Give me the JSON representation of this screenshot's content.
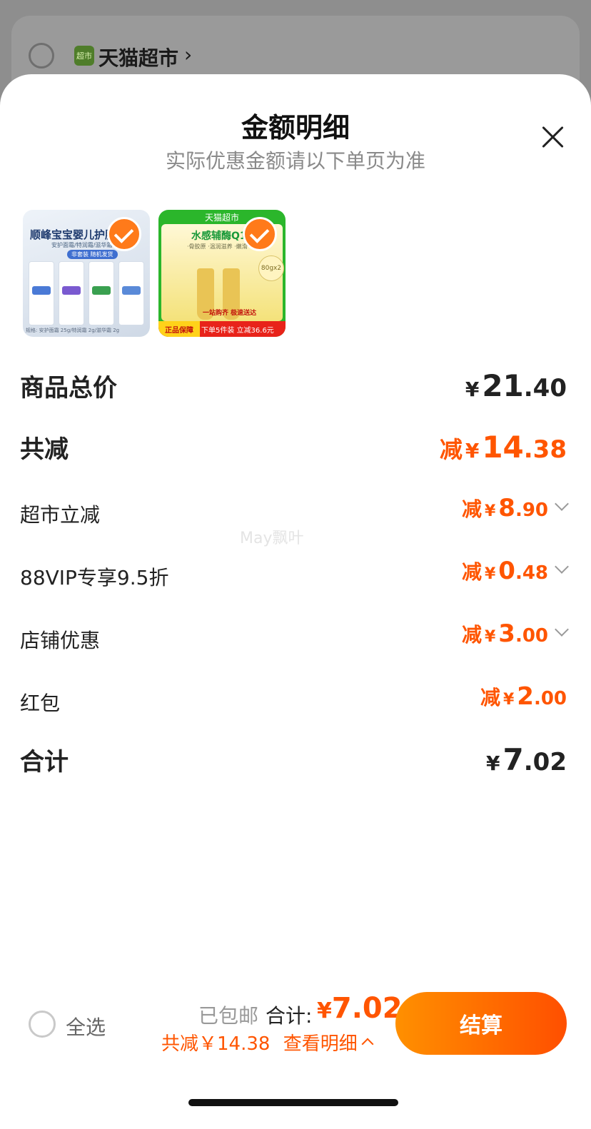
{
  "background": {
    "store_name": "天猫超市",
    "store_icon_text": "超市",
    "chevron": "›"
  },
  "sheet": {
    "title": "金额明细",
    "subtitle": "实际优惠金额请以下单页为准",
    "close_icon": "close-icon"
  },
  "products": [
    {
      "name_text": "顺峰宝宝婴儿护肤",
      "sub_text": "安护面霜/特润霜/滋华霜",
      "tag_text": "非套装 随机发货",
      "footer_text": "规格: 安护面霜 25g/特润霜 2g/滋华霜 2g",
      "checked": true
    },
    {
      "top_text": "天猫超市",
      "name_text": "水感辅酶Q10",
      "sub_text": "·骨胶原 ·温润滋养 ·嫩滑",
      "badge_text": "80gx2",
      "promo_text": "一站购齐 极速送达",
      "footer_left": "正品保障",
      "footer_right": "下单5件装 立减36.6元",
      "checked": true
    }
  ],
  "rows": {
    "subtotal": {
      "label": "商品总价",
      "currency": "¥",
      "int": "21",
      "dec": ".40"
    },
    "total_reduce": {
      "label": "共减",
      "prefix": "减",
      "currency": "¥",
      "int": "14",
      "dec": ".38"
    },
    "supermarket": {
      "label": "超市立减",
      "prefix": "减",
      "currency": "¥",
      "int": "8",
      "dec": ".90"
    },
    "vip": {
      "label": "88VIP专享9.5折",
      "prefix": "减",
      "currency": "¥",
      "int": "0",
      "dec": ".48"
    },
    "store": {
      "label": "店铺优惠",
      "prefix": "减",
      "currency": "¥",
      "int": "3",
      "dec": ".00"
    },
    "redpacket": {
      "label": "红包",
      "prefix": "减",
      "currency": "¥",
      "int": "2",
      "dec": ".00"
    },
    "total": {
      "label": "合计",
      "currency": "¥",
      "int": "7",
      "dec": ".02"
    }
  },
  "watermark": "May飘叶",
  "bottom": {
    "select_all": "全选",
    "shipping": "已包邮",
    "total_label": "合计:",
    "total_currency": "¥",
    "total_value": "7.02",
    "saved_text": "共减￥14.38",
    "detail_link": "查看明细",
    "checkout": "结算"
  },
  "colors": {
    "accent": "#ff5500",
    "checkout_gradient_start": "#ff9000",
    "checkout_gradient_end": "#ff4f00"
  }
}
